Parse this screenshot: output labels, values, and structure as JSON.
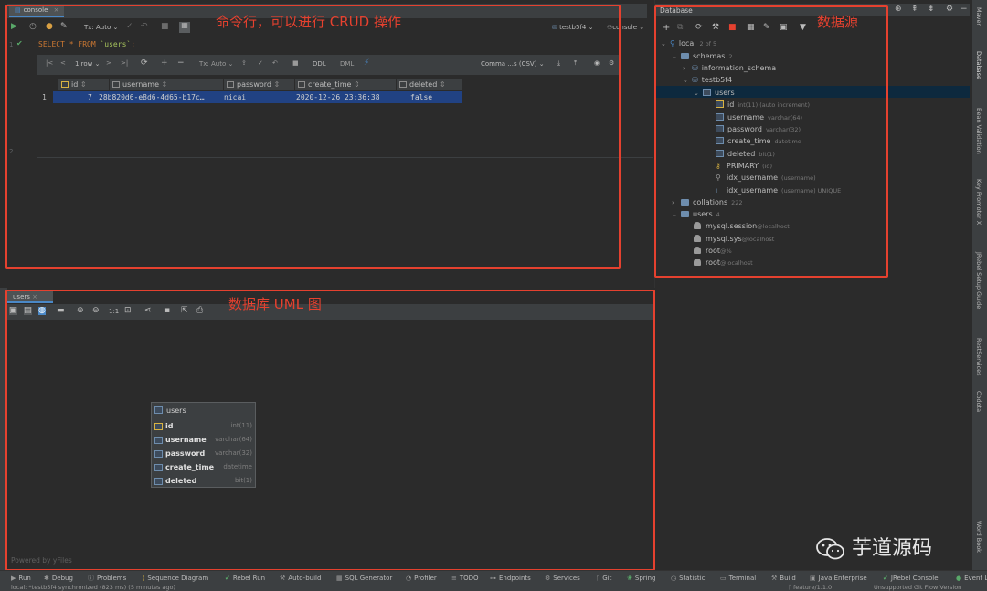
{
  "editor": {
    "tab_label": "console",
    "toolbar": {
      "tx_mode": "Tx: Auto",
      "datasource": "testb5f4",
      "session": "console"
    },
    "line_numbers": [
      "1",
      "2"
    ],
    "sql": {
      "kw_select": "SELECT",
      "star": "*",
      "kw_from": "FROM",
      "table": "`users`",
      "semicolon": ";"
    }
  },
  "result": {
    "toolbar": {
      "row_count": "1 row",
      "tx_mode": "Tx: Auto",
      "ddl": "DDL",
      "dml": "DML",
      "export_format": "Comma ...s (CSV)"
    },
    "columns": [
      {
        "name": "id"
      },
      {
        "name": "username"
      },
      {
        "name": "password"
      },
      {
        "name": "create_time"
      },
      {
        "name": "deleted"
      }
    ],
    "rows": [
      {
        "num": "1",
        "id": "7",
        "username": "28b820d6-e8d6-4d65-b17c…",
        "password": "nicai",
        "create_time": "2020-12-26 23:36:38",
        "deleted": "false"
      }
    ]
  },
  "database": {
    "title": "Database",
    "tree": {
      "root": {
        "label": "local",
        "sub": "2 of 5"
      },
      "schemas": {
        "label": "schemas",
        "sub": "2"
      },
      "information_schema": {
        "label": "information_schema"
      },
      "testb5f4": {
        "label": "testb5f4"
      },
      "users_table": {
        "label": "users"
      },
      "columns": [
        {
          "label": "id",
          "sub": "int(11) (auto increment)"
        },
        {
          "label": "username",
          "sub": "varchar(64)"
        },
        {
          "label": "password",
          "sub": "varchar(32)"
        },
        {
          "label": "create_time",
          "sub": "datetime"
        },
        {
          "label": "deleted",
          "sub": "bit(1)"
        }
      ],
      "keys": [
        {
          "label": "PRIMARY",
          "sub": "(id)"
        },
        {
          "label": "idx_username",
          "sub": "(username)"
        },
        {
          "label": "idx_username",
          "sub": "(username) UNIQUE"
        }
      ],
      "collations": {
        "label": "collations",
        "sub": "222"
      },
      "users_group": {
        "label": "users",
        "sub": "4"
      },
      "users": [
        {
          "label": "mysql.session",
          "sub": "@localhost"
        },
        {
          "label": "mysql.sys",
          "sub": "@localhost"
        },
        {
          "label": "root",
          "sub": "@%"
        },
        {
          "label": "root",
          "sub": "@localhost"
        }
      ]
    }
  },
  "diagram": {
    "tab_label": "users",
    "zoom_label": "1:1",
    "table": {
      "title": "users",
      "fields": [
        {
          "name": "id",
          "type": "int(11)"
        },
        {
          "name": "username",
          "type": "varchar(64)"
        },
        {
          "name": "password",
          "type": "varchar(32)"
        },
        {
          "name": "create_time",
          "type": "datetime"
        },
        {
          "name": "deleted",
          "type": "bit(1)"
        }
      ]
    },
    "powered_by": "Powered by yFiles"
  },
  "annotations": {
    "editor": "命令行，可以进行 CRUD 操作",
    "datasource": "数据源",
    "diagram": "数据库 UML 图"
  },
  "right_tabs": [
    "Maven",
    "Database",
    "Bean Validation",
    "Key Promoter X",
    "JRebel Setup Guide",
    "RestServices",
    "Codota",
    "Word Book"
  ],
  "bottom_tools": [
    "Run",
    "Debug",
    "Problems",
    "Sequence Diagram",
    "Rebel Run",
    "Auto-build",
    "SQL Generator",
    "Profiler",
    "TODO",
    "Endpoints",
    "Services",
    "Git",
    "Spring",
    "Statistic",
    "Terminal",
    "Build",
    "Java Enterprise",
    "JRebel Console",
    "Event L"
  ],
  "status": {
    "left": "local: *testb5f4 synchronized (823 ms) (5 minutes ago)",
    "branch": "feature/1.1.0",
    "right": "Unsupported Git Flow Version"
  },
  "watermark": "芋道源码",
  "colors": {
    "accent": "#e5412f",
    "selection": "#214283",
    "background": "#2b2b2b",
    "panel": "#3c3f41"
  }
}
